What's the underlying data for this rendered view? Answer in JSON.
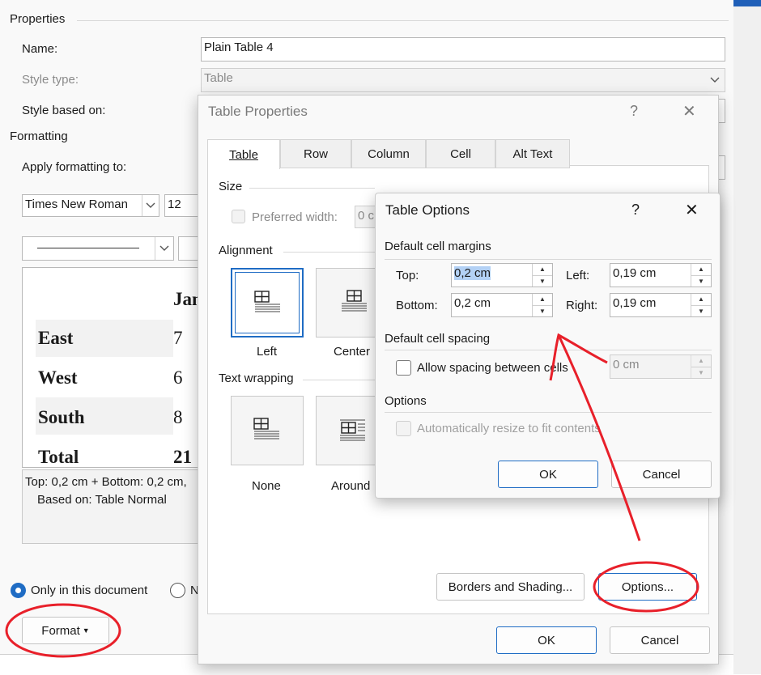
{
  "modify_style": {
    "properties_heading": "Properties",
    "name_label": "Name:",
    "name_value": "Plain Table 4",
    "style_type_label": "Style type:",
    "style_type_value": "Table",
    "style_based_label": "Style based on:",
    "formatting_heading": "Formatting",
    "apply_to_label": "Apply formatting to:",
    "font_value": "Times New Roman",
    "size_value": "12",
    "preview": {
      "header": "Jan",
      "rows": [
        {
          "label": "East",
          "value": "7"
        },
        {
          "label": "West",
          "value": "6"
        },
        {
          "label": "South",
          "value": "8"
        },
        {
          "label": "Total",
          "value": "21"
        }
      ]
    },
    "description_line1": "Top:  0,2 cm + Bottom:  0,2 cm,",
    "description_line2": "Based on: Table Normal",
    "only_doc_label": "Only in this document",
    "new_docs_label": "N",
    "format_button": "Format"
  },
  "table_properties": {
    "title": "Table Properties",
    "help": "?",
    "close": "✕",
    "tabs": [
      "Table",
      "Row",
      "Column",
      "Cell",
      "Alt Text"
    ],
    "active_tab": "Table",
    "size_heading": "Size",
    "preferred_width_label": "Preferred width:",
    "preferred_width_value": "0 c",
    "alignment_heading": "Alignment",
    "align_left": "Left",
    "align_center": "Center",
    "wrapping_heading": "Text wrapping",
    "wrap_none": "None",
    "wrap_around": "Around",
    "borders_button": "Borders and Shading...",
    "options_button": "Options...",
    "ok_button": "OK",
    "cancel_button": "Cancel"
  },
  "table_options": {
    "title": "Table Options",
    "help": "?",
    "close": "✕",
    "margins_heading": "Default cell margins",
    "top_label": "Top:",
    "top_value": "0,2 cm",
    "bottom_label": "Bottom:",
    "bottom_value": "0,2 cm",
    "left_label": "Left:",
    "left_value": "0,19 cm",
    "right_label": "Right:",
    "right_value": "0,19 cm",
    "spacing_heading": "Default cell spacing",
    "allow_spacing_label": "Allow spacing between cells",
    "spacing_value": "0 cm",
    "options_heading": "Options",
    "auto_resize_label": "Automatically resize to fit contents",
    "ok_button": "OK",
    "cancel_button": "Cancel"
  },
  "colors": {
    "accent": "#1f6cc4",
    "annotation": "#e8202a"
  }
}
